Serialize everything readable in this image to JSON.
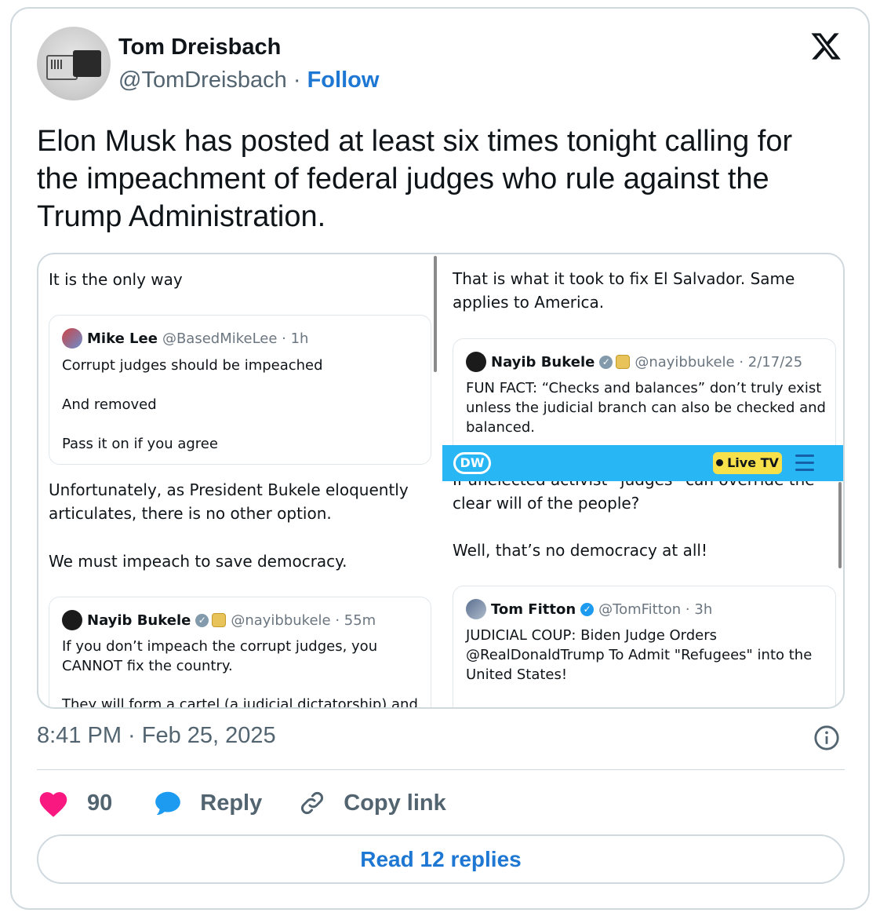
{
  "author": {
    "name": "Tom Dreisbach",
    "handle": "@TomDreisbach",
    "separator": "·",
    "follow_label": "Follow"
  },
  "tweet": {
    "text": "Elon Musk has posted at least six times tonight calling for the impeachment of federal judges who rule against the Trump Administration.",
    "timestamp": "8:41 PM · Feb 25, 2025"
  },
  "media": {
    "left": {
      "post1_text": "It is the only way",
      "quote1": {
        "name": "Mike Lee",
        "handle": "@BasedMikeLee · 1h",
        "line1": "Corrupt judges should be impeached",
        "line2": "And removed",
        "line3": "Pass it on if you agree"
      },
      "post2_line1": "Unfortunately, as President Bukele eloquently",
      "post2_line2": "articulates, there is no other option.",
      "post2_line3": "We must impeach to save democracy.",
      "quote2": {
        "name": "Nayib Bukele",
        "handle": "@nayibbukele · 55m",
        "line1": "If you don’t impeach the corrupt judges, you",
        "line2": "CANNOT fix the country.",
        "line3": "They will form a cartel (a judicial dictatorship) and"
      }
    },
    "right": {
      "post1_line1": "That is what it took to fix El Salvador. Same",
      "post1_line2": "applies to America.",
      "quote1": {
        "name": "Nayib Bukele",
        "handle": "@nayibbukele · 2/17/25",
        "line1": "FUN FACT: “Checks and balances” don’t truly exist",
        "line2": "unless the judicial branch can also be checked and",
        "line3": "balanced."
      },
      "banner": {
        "logo": "DW",
        "live_label": "Live TV",
        "icon": "hamburger-menu-icon"
      },
      "cut_line": "If unelected activist “judges” can override the",
      "post2_line1": "clear will of the people?",
      "post2_line2": "Well, that’s no democracy at all!",
      "quote2": {
        "name": "Tom Fitton",
        "handle": "@TomFitton · 3h",
        "line1": "JUDICIAL COUP: Biden Judge Orders",
        "line2": "@RealDonaldTrump To Admit \"Refugees\" into the",
        "line3": "United States!"
      }
    }
  },
  "actions": {
    "like_count": "90",
    "reply_label": "Reply",
    "copy_label": "Copy link"
  },
  "read_replies_label": "Read 12 replies",
  "colors": {
    "like": "#f91880",
    "reply": "#1d9bf0",
    "link": "#1d77d3",
    "border": "#cfd9de",
    "dw_blue": "#28b7f4",
    "live_yellow": "#f7e14b"
  }
}
